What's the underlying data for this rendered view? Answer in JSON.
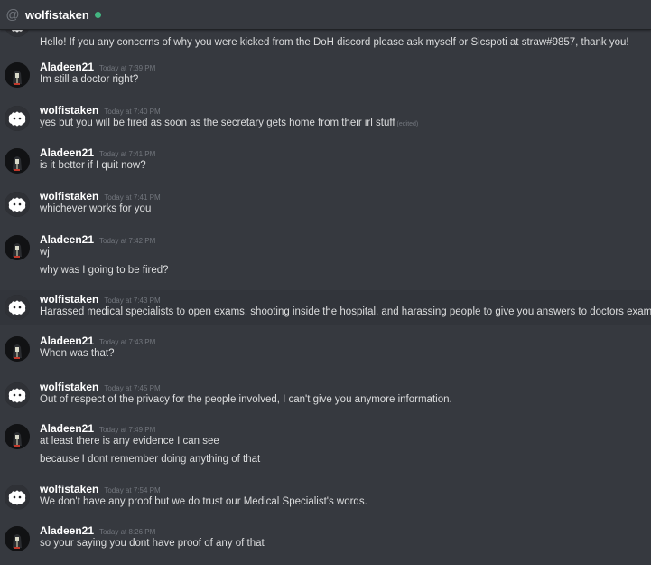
{
  "header": {
    "icon": "at-icon",
    "username": "wolfistaken",
    "status_color": "#43b581"
  },
  "messages": [
    {
      "author": "",
      "time": "",
      "lines": [
        "Hello! If you any concerns of why you were kicked from the DoH discord please ask myself or Sicspoti at straw#9857, thank you!"
      ]
    },
    {
      "author": "Aladeen21",
      "time": "Today at 7:39 PM",
      "lines": [
        "Im still a doctor right?"
      ]
    },
    {
      "author": "wolfistaken",
      "time": "Today at 7:40 PM",
      "lines": [
        "yes but you will be fired as soon as the secretary gets home from their irl stuff"
      ],
      "edited": "(edited)"
    },
    {
      "author": "Aladeen21",
      "time": "Today at 7:41 PM",
      "lines": [
        "is it better if I quit now?"
      ]
    },
    {
      "author": "wolfistaken",
      "time": "Today at 7:41 PM",
      "lines": [
        "whichever works for you"
      ]
    },
    {
      "author": "Aladeen21",
      "time": "Today at 7:42 PM",
      "lines": [
        "wj",
        "why was I going to be fired?"
      ]
    },
    {
      "author": "wolfistaken",
      "time": "Today at 7:43 PM",
      "lines": [
        "Harassed medical specialists to open exams, shooting inside the hospital, and harassing people to give you answers to doctors exams."
      ]
    },
    {
      "author": "Aladeen21",
      "time": "Today at 7:43 PM",
      "lines": [
        "When was that?"
      ]
    },
    {
      "author": "wolfistaken",
      "time": "Today at 7:45 PM",
      "lines": [
        "Out of respect of the privacy for the people involved, I can't give you anymore information."
      ]
    },
    {
      "author": "Aladeen21",
      "time": "Today at 7:49 PM",
      "lines": [
        "at least there is any evidence I can see",
        "because I dont remember doing anything of that"
      ]
    },
    {
      "author": "wolfistaken",
      "time": "Today at 7:54 PM",
      "lines": [
        "We don't have any proof but we do trust our Medical Specialist's words."
      ]
    },
    {
      "author": "Aladeen21",
      "time": "Today at 8:26 PM",
      "lines": [
        "so your saying you dont have proof of any of that"
      ]
    }
  ],
  "avatars": {
    "wolfistaken": "wolf-avatar-icon",
    "Aladeen21": "hooded-figure-avatar-icon"
  }
}
